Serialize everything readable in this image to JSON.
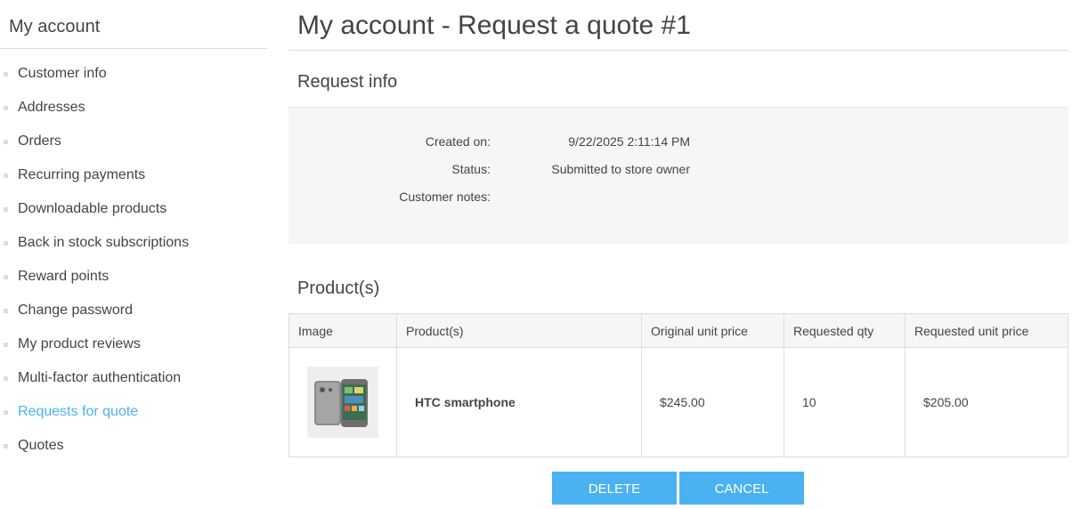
{
  "sidebar": {
    "title": "My account",
    "items": [
      {
        "label": "Customer info"
      },
      {
        "label": "Addresses"
      },
      {
        "label": "Orders"
      },
      {
        "label": "Recurring payments"
      },
      {
        "label": "Downloadable products"
      },
      {
        "label": "Back in stock subscriptions"
      },
      {
        "label": "Reward points"
      },
      {
        "label": "Change password"
      },
      {
        "label": "My product reviews"
      },
      {
        "label": "Multi-factor authentication"
      },
      {
        "label": "Requests for quote"
      },
      {
        "label": "Quotes"
      }
    ],
    "active_item": "Requests for quote"
  },
  "page": {
    "title": "My account - Request a quote #1"
  },
  "request_info": {
    "title": "Request info",
    "created_on_label": "Created on:",
    "created_on_value": "9/22/2025 2:11:14 PM",
    "status_label": "Status:",
    "status_value": "Submitted to store owner",
    "notes_label": "Customer notes:",
    "notes_value": ""
  },
  "products": {
    "title": "Product(s)",
    "columns": [
      "Image",
      "Product(s)",
      "Original unit price",
      "Requested qty",
      "Requested unit price"
    ],
    "rows": [
      {
        "image_icon": "htc-smartphone-photo",
        "name": "HTC smartphone",
        "original_unit_price": "$245.00",
        "requested_qty": "10",
        "requested_unit_price": "$205.00"
      }
    ]
  },
  "actions": {
    "delete_label": "DELETE",
    "cancel_label": "CANCEL"
  },
  "colors": {
    "accent": "#4ab2f1",
    "text": "#444444",
    "panel_bg": "#f6f6f6",
    "border": "#dddddd"
  }
}
